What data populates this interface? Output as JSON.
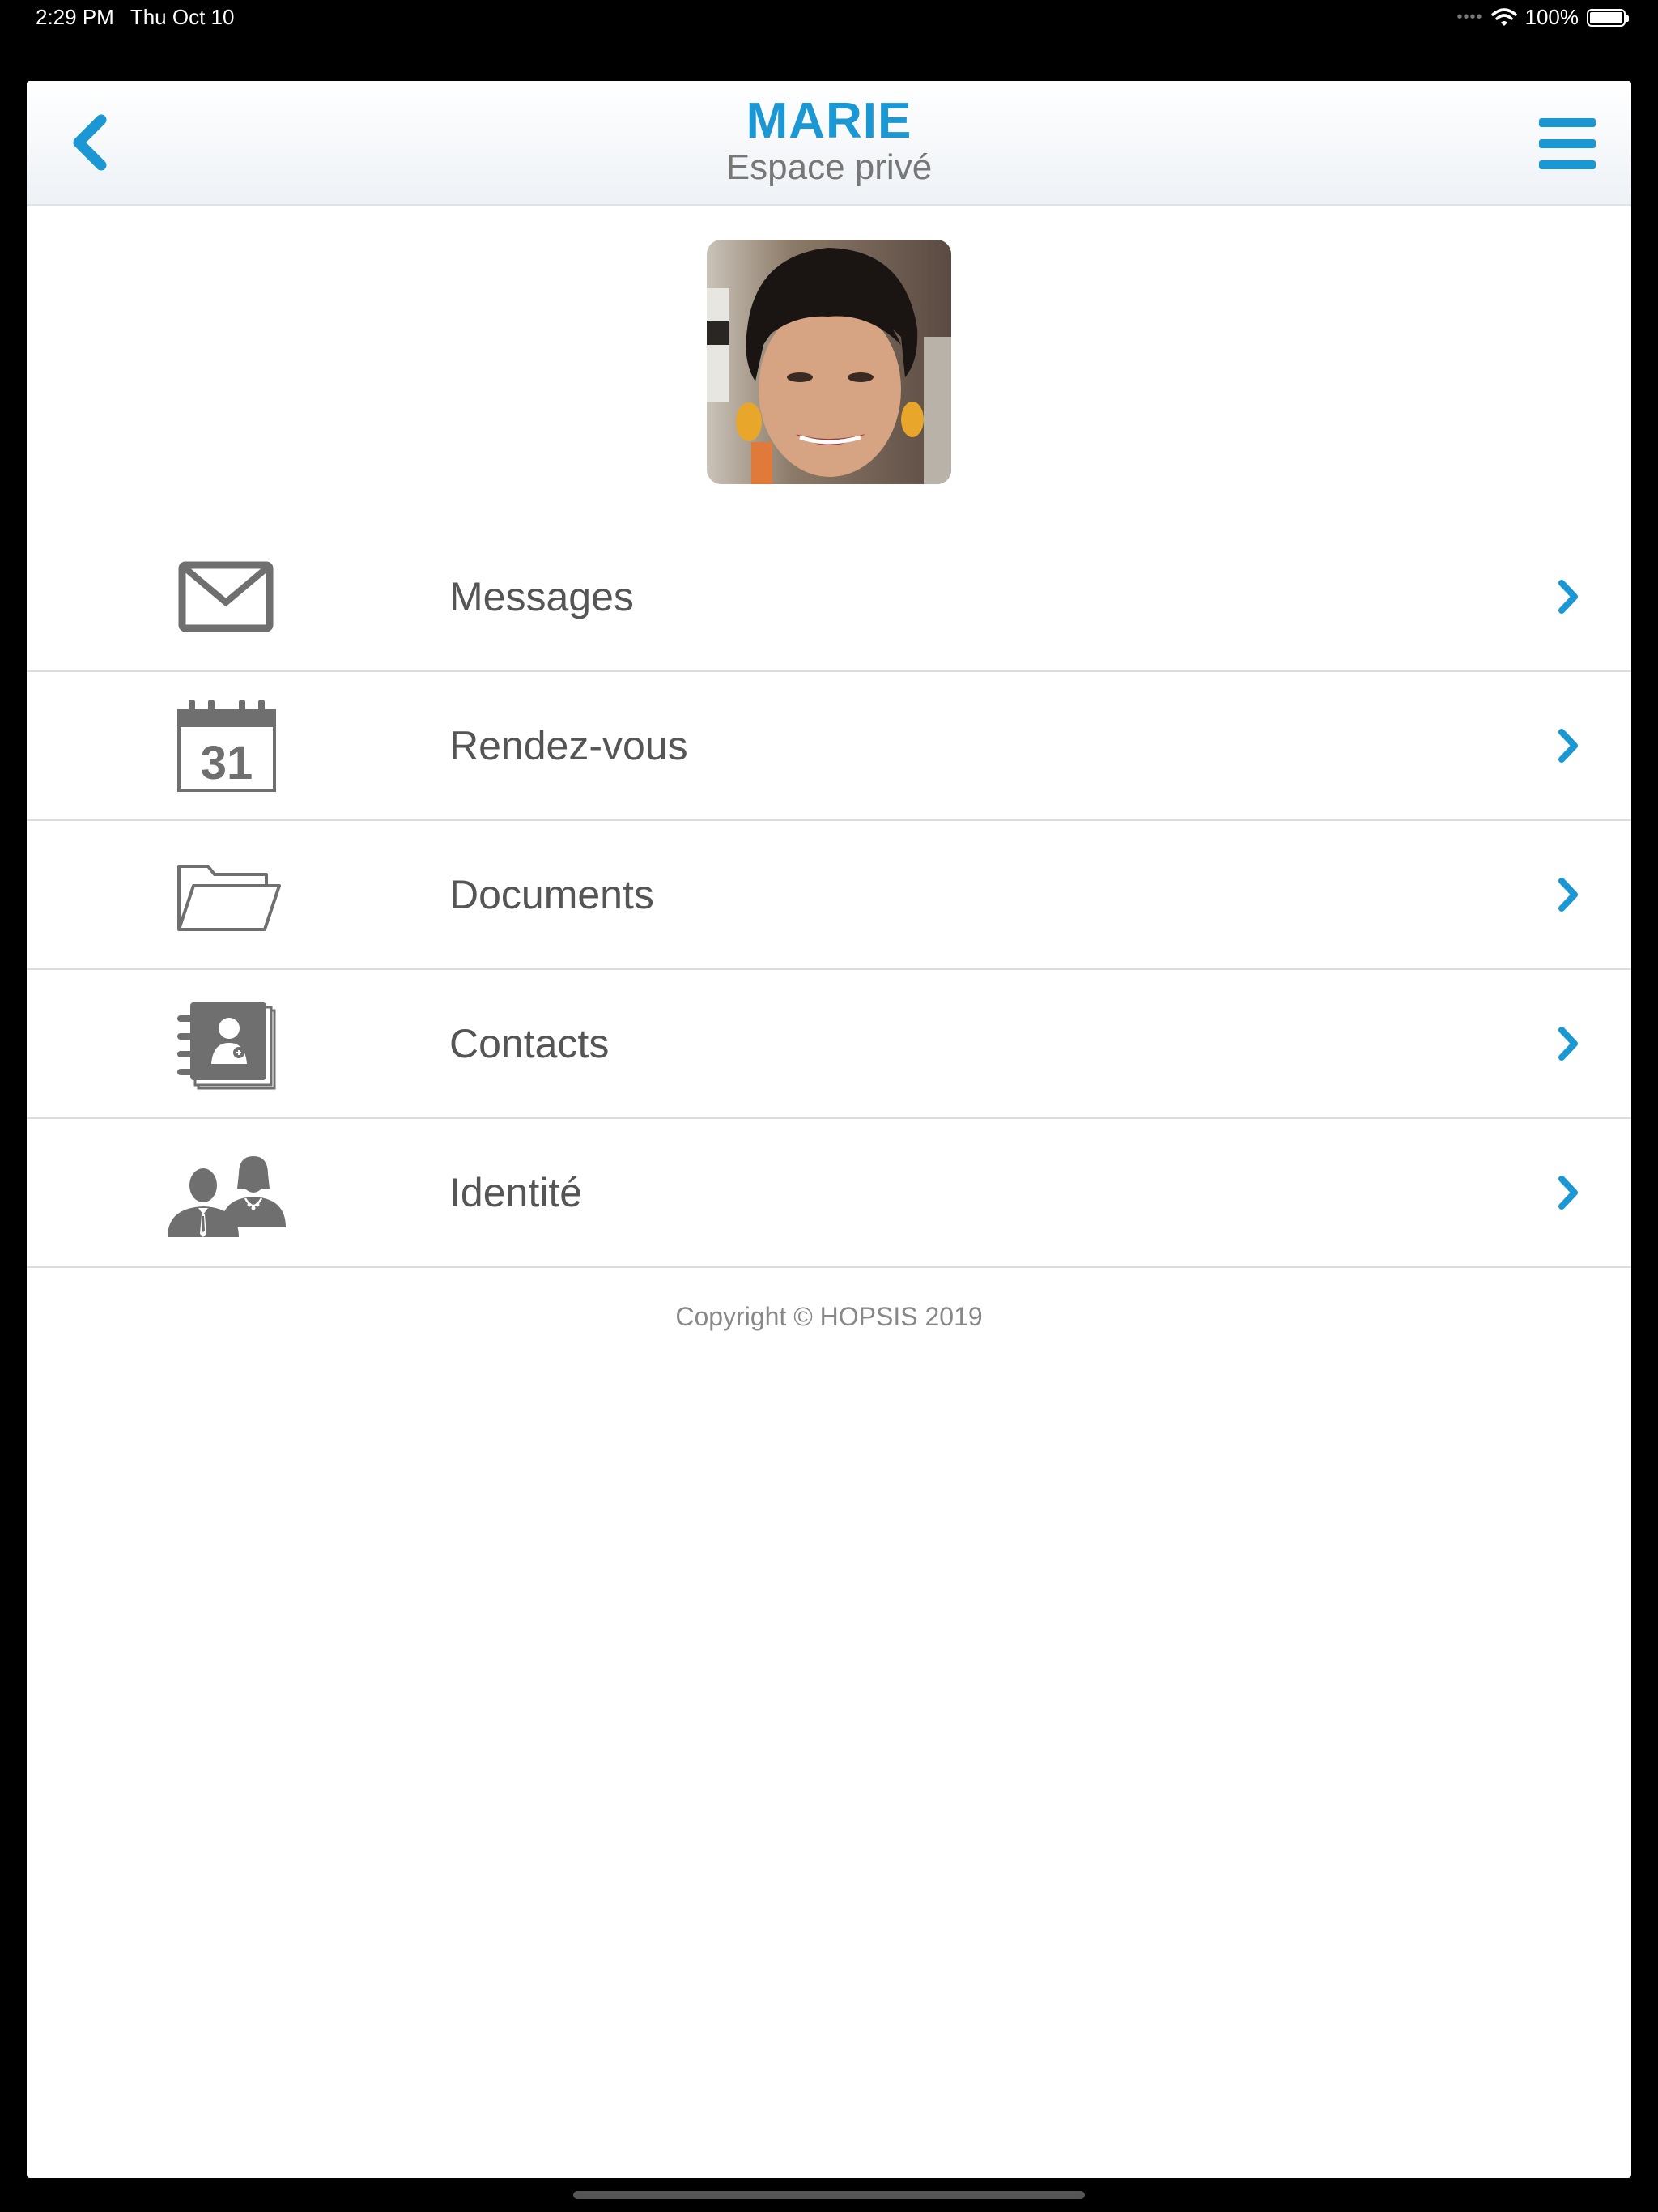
{
  "status_bar": {
    "time": "2:29 PM",
    "date": "Thu Oct 10",
    "battery": "100%",
    "icons": [
      "cellular-signal-icon",
      "wifi-icon",
      "battery-icon"
    ]
  },
  "header": {
    "title": "MARIE",
    "subtitle": "Espace privé",
    "back_icon": "chevron-left-icon",
    "menu_icon": "hamburger-menu-icon"
  },
  "menu": [
    {
      "label": "Messages",
      "icon": "envelope-icon"
    },
    {
      "label": "Rendez-vous",
      "icon": "calendar-icon",
      "icon_text": "31"
    },
    {
      "label": "Documents",
      "icon": "folder-icon"
    },
    {
      "label": "Contacts",
      "icon": "address-book-icon"
    },
    {
      "label": "Identité",
      "icon": "users-icon"
    }
  ],
  "footer": {
    "copyright": "Copyright © HOPSIS 2019"
  },
  "colors": {
    "accent": "#1b98d4",
    "icon_gray": "#6f6f6f",
    "text_gray": "#555555"
  }
}
